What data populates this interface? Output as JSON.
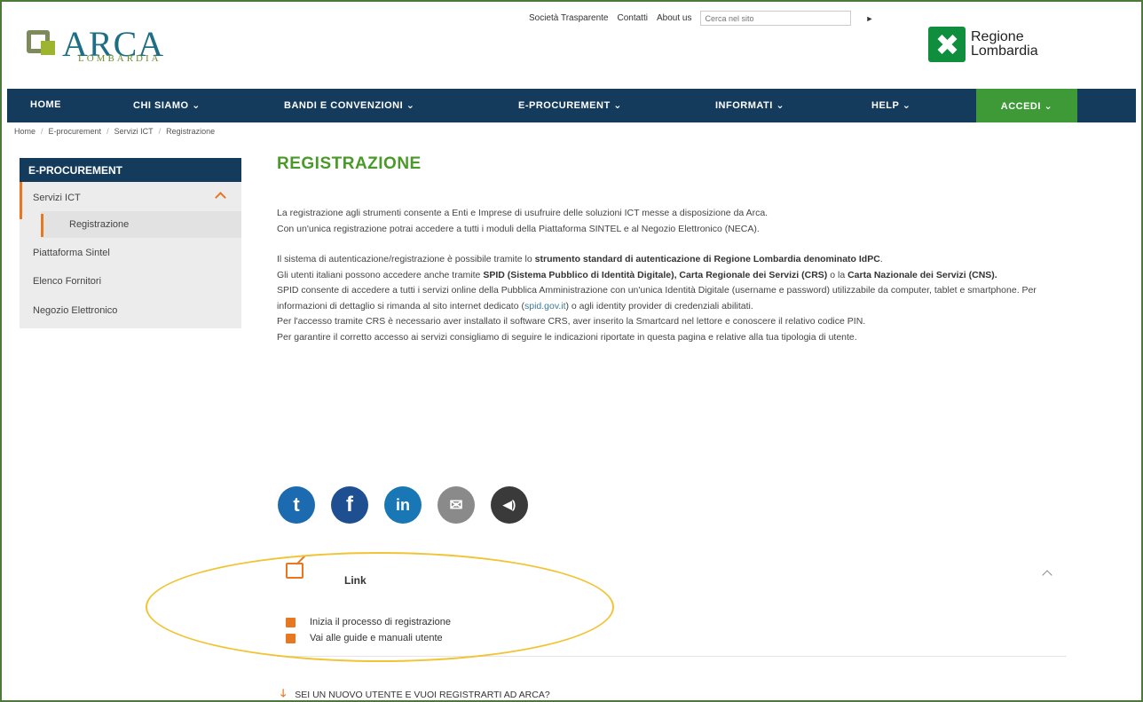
{
  "logo": {
    "word": "ARCA",
    "sub": "LOMBARDIA"
  },
  "utility": {
    "items": [
      "Società Trasparente",
      "Contatti",
      "About us"
    ],
    "search_placeholder": "Cerca nel sito",
    "search_button": "►"
  },
  "region_logo": {
    "line1": "Regione",
    "line2": "Lombardia"
  },
  "nav": {
    "items": [
      "HOME",
      "CHI SIAMO ⌄",
      "BANDI E CONVENZIONI ⌄",
      "E-PROCUREMENT ⌄",
      "INFORMATI ⌄",
      "HELP ⌄"
    ],
    "accedi": "ACCEDI ⌄"
  },
  "breadcrumb": [
    "Home",
    "E-procurement",
    "Servizi ICT",
    "Registrazione"
  ],
  "sidebar": {
    "header": "E-PROCUREMENT",
    "active": "Servizi ICT",
    "sub_active": "Registrazione",
    "items": [
      "Piattaforma Sintel",
      "Elenco Fornitori",
      "Negozio Elettronico"
    ]
  },
  "main": {
    "title": "REGISTRAZIONE",
    "p1": "La registrazione agli strumenti consente a Enti e Imprese di usufruire delle soluzioni ICT messe a disposizione da Arca.",
    "p2": "Con un'unica registrazione potrai accedere a tutti i moduli della Piattaforma SINTEL e al Negozio Elettronico (NECA).",
    "p3a": "Il sistema di autenticazione/registrazione è possibile tramite lo ",
    "p3b": "strumento standard di autenticazione di Regione Lombardia denominato IdPC",
    "p3c": ".",
    "p4a": "Gli utenti italiani possono accedere anche tramite ",
    "p4b": "SPID (Sistema Pubblico di Identità Digitale), Carta Regionale dei Servizi (CRS)",
    "p4c": " o la ",
    "p4d": "Carta Nazionale dei Servizi (CNS).",
    "p5a": "SPID consente di accedere a tutti i servizi online della Pubblica Amministrazione con un'unica Identità Digitale (username e password) utilizzabile da computer, tablet e smartphone. Per informazioni di dettaglio si rimanda al sito internet dedicato (",
    "p5link": "spid.gov.it",
    "p5b": ") o agli identity provider di credenziali abilitati.",
    "p6": "Per l'accesso tramite CRS è necessario aver installato il software CRS, aver inserito la Smartcard nel lettore e conoscere il relativo codice PIN.",
    "p7": "Per garantire il corretto accesso ai servizi consigliamo di seguire le indicazioni riportate in questa pagina e relative alla tua tipologia di utente."
  },
  "social": {
    "twitter": "t",
    "facebook": "f",
    "linkedin": "in",
    "email": "✉",
    "audio": "◀)"
  },
  "links": {
    "label": "Link",
    "items": [
      "Inizia il processo di registrazione",
      "Vai alle guide e manuali utente"
    ]
  },
  "new_user": "SEI UN NUOVO UTENTE E VUOI REGISTRARTI AD ARCA?"
}
